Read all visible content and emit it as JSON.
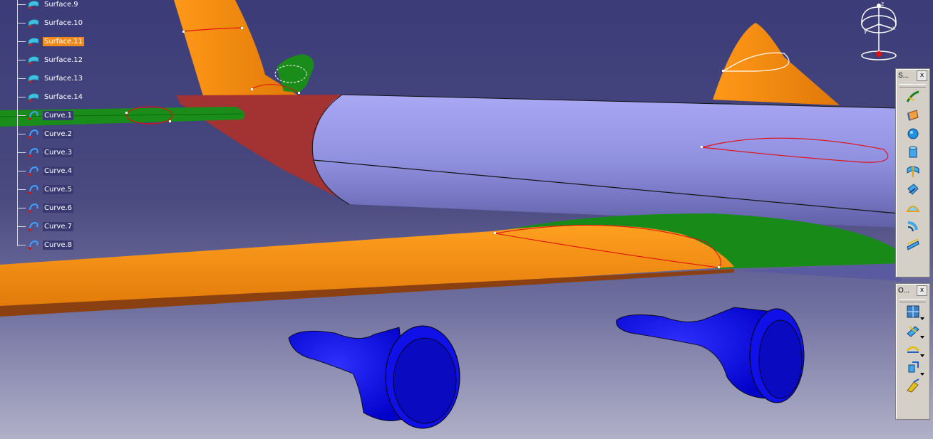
{
  "tree": {
    "items": [
      {
        "label": "Surface.9",
        "type": "surface",
        "selected": false
      },
      {
        "label": "Surface.10",
        "type": "surface",
        "selected": false
      },
      {
        "label": "Surface.11",
        "type": "surface",
        "selected": true
      },
      {
        "label": "Surface.12",
        "type": "surface",
        "selected": false
      },
      {
        "label": "Surface.13",
        "type": "surface",
        "selected": false
      },
      {
        "label": "Surface.14",
        "type": "surface",
        "selected": false
      },
      {
        "label": "Curve.1",
        "type": "curve",
        "selected": false
      },
      {
        "label": "Curve.2",
        "type": "curve",
        "selected": false
      },
      {
        "label": "Curve.3",
        "type": "curve",
        "selected": false
      },
      {
        "label": "Curve.4",
        "type": "curve",
        "selected": false
      },
      {
        "label": "Curve.5",
        "type": "curve",
        "selected": false
      },
      {
        "label": "Curve.6",
        "type": "curve",
        "selected": false
      },
      {
        "label": "Curve.7",
        "type": "curve",
        "selected": false
      },
      {
        "label": "Curve.8",
        "type": "curve",
        "selected": false
      }
    ]
  },
  "toolbars": {
    "surfaces": {
      "title": "S...",
      "close": "x",
      "tools": [
        "sweep-icon",
        "extrude-icon",
        "sphere-icon",
        "cylinder-icon",
        "revolve-icon",
        "offset-icon",
        "fill-icon",
        "blend-icon",
        "multi-section-icon"
      ]
    },
    "operations": {
      "title": "O...",
      "close": "x",
      "tools": [
        "join-icon",
        "split-icon",
        "fillet-icon",
        "transform-icon",
        "extrapolate-icon"
      ]
    }
  },
  "compass": {
    "axes": [
      "x",
      "y",
      "z"
    ]
  },
  "colors": {
    "background_top": "#3b3b78",
    "background_bottom": "#b0b0c8",
    "wing": "#f58a10",
    "fuselage": "#9a9ae8",
    "green_surface": "#1a8c1a",
    "nacelle": "#1010e0",
    "fairing": "#a03030",
    "curve": "#e01010",
    "selection": "#f08a1c"
  }
}
